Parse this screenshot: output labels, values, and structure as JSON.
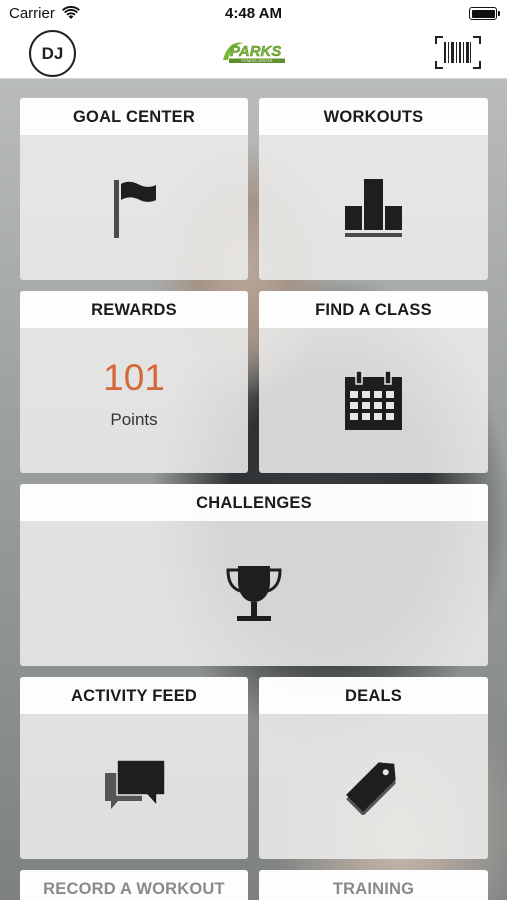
{
  "status_bar": {
    "carrier": "Carrier",
    "time": "4:48 AM"
  },
  "nav": {
    "avatar_initials": "DJ",
    "logo_text": "PARKS",
    "logo_subtext": "FITNESS CENTER"
  },
  "tiles": {
    "goal_center": {
      "title": "GOAL CENTER",
      "icon": "flag-icon"
    },
    "workouts": {
      "title": "WORKOUTS",
      "icon": "bar-chart-icon"
    },
    "rewards": {
      "title": "REWARDS",
      "points_value": "101",
      "points_label": "Points"
    },
    "find_a_class": {
      "title": "FIND A CLASS",
      "icon": "calendar-icon"
    },
    "challenges": {
      "title": "CHALLENGES",
      "icon": "trophy-icon"
    },
    "activity_feed": {
      "title": "ACTIVITY FEED",
      "icon": "chat-bubbles-icon"
    },
    "deals": {
      "title": "DEALS",
      "icon": "tag-icon"
    },
    "record_a_workout": {
      "title": "RECORD A WORKOUT"
    },
    "training": {
      "title": "TRAINING"
    }
  },
  "colors": {
    "accent": "#d5683a",
    "logo_green": "#7bb83a",
    "icon": "#1e1e1e"
  }
}
